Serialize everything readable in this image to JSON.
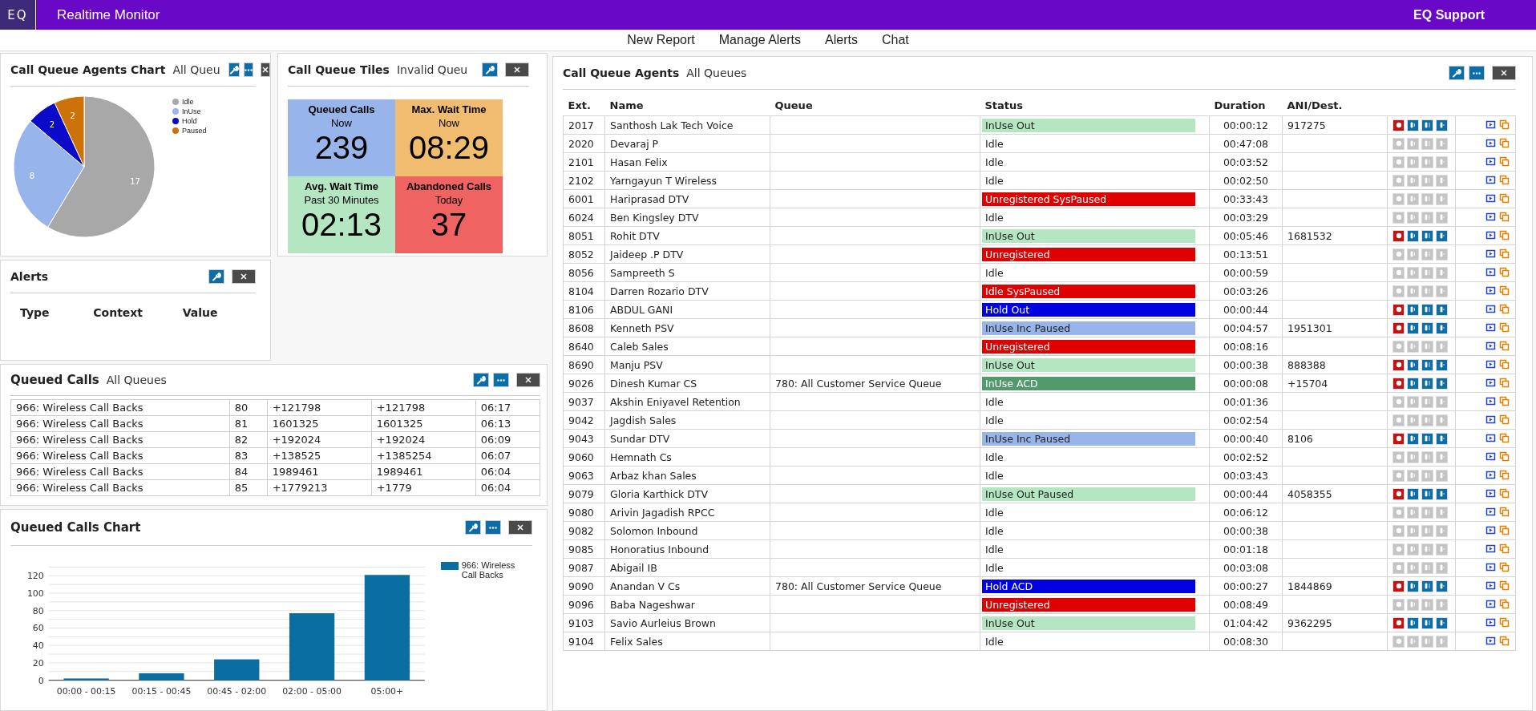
{
  "header": {
    "logo": "EQ",
    "title": "Realtime Monitor",
    "user": "EQ Support"
  },
  "nav": [
    "New Report",
    "Manage Alerts",
    "Alerts",
    "Chat"
  ],
  "agents_chart": {
    "title": "Call Queue Agents Chart",
    "subtitle": "All Queu",
    "chart_data": {
      "type": "pie",
      "categories": [
        "Idle",
        "InUse",
        "Hold",
        "Paused"
      ],
      "values": [
        17,
        8,
        2,
        2
      ],
      "data_labels": true,
      "legend": true
    }
  },
  "tiles": {
    "title": "Call Queue Tiles",
    "subtitle": "Invalid Queu",
    "items": [
      {
        "title": "Queued Calls",
        "subtitle": "Now",
        "value": "239",
        "color": "#97b5ea"
      },
      {
        "title": "Max. Wait Time",
        "subtitle": "Now",
        "value": "08:29",
        "color": "#f0bd70"
      },
      {
        "title": "Avg. Wait Time",
        "subtitle": "Past 30 Minutes",
        "value": "02:13",
        "color": "#b4e6c1"
      },
      {
        "title": "Abandoned Calls",
        "subtitle": "Today",
        "value": "37",
        "color": "#f06363"
      }
    ]
  },
  "alerts": {
    "title": "Alerts",
    "columns": [
      "Type",
      "Context",
      "Value"
    ]
  },
  "queued_calls": {
    "title": "Queued Calls",
    "subtitle": "All Queues",
    "rows": [
      [
        "966: Wireless Call Backs",
        "80",
        "+121798",
        "+121798",
        "06:17"
      ],
      [
        "966: Wireless Call Backs",
        "81",
        "1601325",
        "1601325",
        "06:13"
      ],
      [
        "966: Wireless Call Backs",
        "82",
        "+192024",
        "+192024",
        "06:09"
      ],
      [
        "966: Wireless Call Backs",
        "83",
        "+138525",
        "+1385254",
        "06:07"
      ],
      [
        "966: Wireless Call Backs",
        "84",
        "1989461",
        "1989461",
        "06:04"
      ],
      [
        "966: Wireless Call Backs",
        "85",
        "+1779213",
        "+1779",
        "06:04"
      ]
    ]
  },
  "queued_chart": {
    "title": "Queued Calls Chart",
    "chart_data": {
      "type": "bar",
      "categories": [
        "00:00 - 00:15",
        "00:15 - 00:45",
        "00:45 - 02:00",
        "02:00 - 05:00",
        "05:00+"
      ],
      "series": [
        {
          "name": "966: Wireless Call Backs",
          "color": "#0a6ea3",
          "values": [
            2,
            8,
            24,
            77,
            121
          ]
        }
      ],
      "ylim": [
        0,
        130
      ],
      "yticks": [
        0,
        20,
        40,
        60,
        80,
        100,
        120
      ],
      "grid": true,
      "legend": true
    }
  },
  "agents": {
    "title": "Call Queue Agents",
    "subtitle": "All Queues",
    "columns": [
      "Ext.",
      "Name",
      "Queue",
      "Status",
      "Duration",
      "ANI/Dest."
    ],
    "rows": [
      {
        "ext": "2017",
        "name": "Santhosh Lak Tech Voice",
        "queue": "",
        "status": "InUse Out",
        "color": "#b4e6c1",
        "duration": "00:00:12",
        "ani": "917275",
        "active": true
      },
      {
        "ext": "2020",
        "name": "Devaraj P",
        "queue": "",
        "status": "Idle",
        "duration": "00:47:08",
        "ani": "",
        "active": false
      },
      {
        "ext": "2101",
        "name": "Hasan Felix",
        "queue": "",
        "status": "Idle",
        "duration": "00:03:52",
        "ani": "",
        "active": false
      },
      {
        "ext": "2102",
        "name": "Yarngayun T Wireless",
        "queue": "",
        "status": "Idle",
        "duration": "00:02:50",
        "ani": "",
        "active": false
      },
      {
        "ext": "6001",
        "name": "Hariprasad DTV",
        "queue": "",
        "status": "Unregistered SysPaused",
        "color": "#e00000",
        "duration": "00:33:43",
        "ani": "",
        "active": false
      },
      {
        "ext": "6024",
        "name": "Ben Kingsley DTV",
        "queue": "",
        "status": "Idle",
        "duration": "00:03:29",
        "ani": "",
        "active": false
      },
      {
        "ext": "8051",
        "name": "Rohit DTV",
        "queue": "",
        "status": "InUse Out",
        "color": "#b4e6c1",
        "duration": "00:05:46",
        "ani": "1681532",
        "active": true
      },
      {
        "ext": "8052",
        "name": "Jaideep .P DTV",
        "queue": "",
        "status": "Unregistered",
        "color": "#e00000",
        "duration": "00:13:51",
        "ani": "",
        "active": false
      },
      {
        "ext": "8056",
        "name": "Sampreeth S",
        "queue": "",
        "status": "Idle",
        "duration": "00:00:59",
        "ani": "",
        "active": false
      },
      {
        "ext": "8104",
        "name": "Darren Rozario DTV",
        "queue": "",
        "status": "Idle SysPaused",
        "color": "#e00000",
        "duration": "00:03:26",
        "ani": "",
        "active": false
      },
      {
        "ext": "8106",
        "name": "ABDUL GANI",
        "queue": "",
        "status": "Hold Out",
        "color": "#0000e0",
        "duration": "00:00:44",
        "ani": "",
        "active": true
      },
      {
        "ext": "8608",
        "name": "Kenneth PSV",
        "queue": "",
        "status": "InUse Inc Paused",
        "color": "#97b5ea",
        "duration": "00:04:57",
        "ani": "1951301",
        "active": true
      },
      {
        "ext": "8640",
        "name": "Caleb Sales",
        "queue": "",
        "status": "Unregistered",
        "color": "#e00000",
        "duration": "00:08:16",
        "ani": "",
        "active": false
      },
      {
        "ext": "8690",
        "name": "Manju PSV",
        "queue": "",
        "status": "InUse Out",
        "color": "#b4e6c1",
        "duration": "00:00:38",
        "ani": "888388",
        "active": true
      },
      {
        "ext": "9026",
        "name": "Dinesh Kumar CS",
        "queue": "780: All Customer Service Queue",
        "status": "InUse ACD",
        "color": "#52996c",
        "duration": "00:00:08",
        "ani": "+15704",
        "active": true
      },
      {
        "ext": "9037",
        "name": "Akshin Eniyavel Retention",
        "queue": "",
        "status": "Idle",
        "duration": "00:01:36",
        "ani": "",
        "active": false
      },
      {
        "ext": "9042",
        "name": "Jagdish Sales",
        "queue": "",
        "status": "Idle",
        "duration": "00:02:54",
        "ani": "",
        "active": false
      },
      {
        "ext": "9043",
        "name": "Sundar DTV",
        "queue": "",
        "status": "InUse Inc Paused",
        "color": "#97b5ea",
        "duration": "00:00:40",
        "ani": "8106",
        "active": true
      },
      {
        "ext": "9060",
        "name": "Hemnath Cs",
        "queue": "",
        "status": "Idle",
        "duration": "00:02:52",
        "ani": "",
        "active": false
      },
      {
        "ext": "9063",
        "name": "Arbaz khan Sales",
        "queue": "",
        "status": "Idle",
        "duration": "00:03:43",
        "ani": "",
        "active": false
      },
      {
        "ext": "9079",
        "name": "Gloria Karthick DTV",
        "queue": "",
        "status": "InUse Out Paused",
        "color": "#b4e6c1",
        "duration": "00:00:44",
        "ani": "4058355",
        "active": true
      },
      {
        "ext": "9080",
        "name": "Arivin Jagadish RPCC",
        "queue": "",
        "status": "Idle",
        "duration": "00:06:12",
        "ani": "",
        "active": false
      },
      {
        "ext": "9082",
        "name": "Solomon Inbound",
        "queue": "",
        "status": "Idle",
        "duration": "00:00:38",
        "ani": "",
        "active": false
      },
      {
        "ext": "9085",
        "name": "Honoratius Inbound",
        "queue": "",
        "status": "Idle",
        "duration": "00:01:18",
        "ani": "",
        "active": false
      },
      {
        "ext": "9087",
        "name": "Abigail IB",
        "queue": "",
        "status": "Idle",
        "duration": "00:03:08",
        "ani": "",
        "active": false
      },
      {
        "ext": "9090",
        "name": "Anandan V Cs",
        "queue": "780: All Customer Service Queue",
        "status": "Hold ACD",
        "color": "#0000e0",
        "duration": "00:00:27",
        "ani": "1844869",
        "active": true
      },
      {
        "ext": "9096",
        "name": "Baba Nageshwar",
        "queue": "",
        "status": "Unregistered",
        "color": "#e00000",
        "duration": "00:08:49",
        "ani": "",
        "active": false
      },
      {
        "ext": "9103",
        "name": "Savio Aurleius Brown",
        "queue": "",
        "status": "InUse Out",
        "color": "#b4e6c1",
        "duration": "01:04:42",
        "ani": "9362295",
        "active": true
      },
      {
        "ext": "9104",
        "name": "Felix Sales",
        "queue": "",
        "status": "Idle",
        "duration": "00:08:30",
        "ani": "",
        "active": false
      }
    ]
  }
}
